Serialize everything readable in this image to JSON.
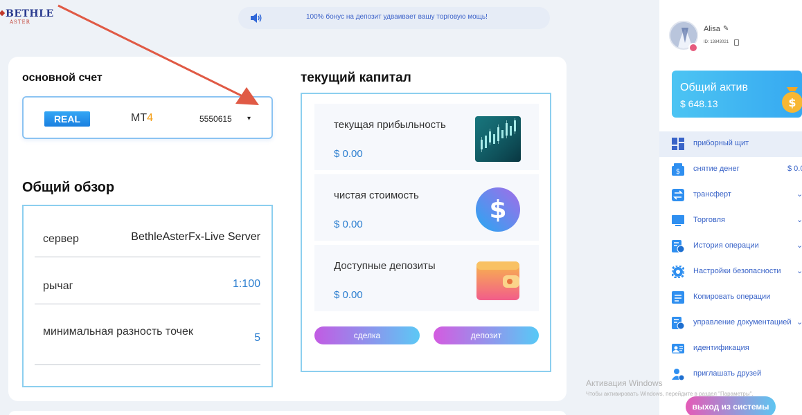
{
  "header": {
    "logo_main": "BETHLE",
    "logo_sub": "ASTER",
    "announcement": "100% бонус на депозит удваивает вашу торговую мощь!"
  },
  "account": {
    "title": "основной счет",
    "badge": "REAL",
    "platform_prefix": "MT",
    "platform_suffix": "4",
    "selected_account": "5550615"
  },
  "overview": {
    "title": "Общий обзор",
    "rows": [
      {
        "label": "сервер",
        "value": "BethleAsterFx-Live Server"
      },
      {
        "label": "рычаг",
        "value": "1:100"
      },
      {
        "label": "минимальная разность точек",
        "value": "5"
      }
    ]
  },
  "capital": {
    "title": "текущий капитал",
    "cards": [
      {
        "title": "текущая прибыльность",
        "value": "$ 0.00"
      },
      {
        "title": "чистая стоимость",
        "value": "$ 0.00"
      },
      {
        "title": "Доступные депозиты",
        "value": "$ 0.00"
      }
    ],
    "deal_button": "сделка",
    "deposit_button": "депозит"
  },
  "user": {
    "name": "Alisa",
    "id_label": "ID: 13843021"
  },
  "assets": {
    "title": "Общий актив",
    "value": "$ 648.13"
  },
  "nav": {
    "items": [
      {
        "label": "приборный щит",
        "icon": "dashboard-icon"
      },
      {
        "label": "снятие денег",
        "icon": "withdraw-icon",
        "extra": "$ 0.0"
      },
      {
        "label": "трансферт",
        "icon": "transfer-icon"
      },
      {
        "label": "Торговля",
        "icon": "trade-icon"
      },
      {
        "label": "История операции",
        "icon": "history-icon"
      },
      {
        "label": "Настройки безопасности",
        "icon": "gear-icon"
      },
      {
        "label": "Копировать операции",
        "icon": "copy-trade-icon"
      },
      {
        "label": "управление документацией",
        "icon": "documents-icon"
      },
      {
        "label": "идентификация",
        "icon": "id-card-icon"
      },
      {
        "label": "приглашать друзей",
        "icon": "invite-icon"
      }
    ],
    "logout": "выход из системы"
  },
  "watermark": {
    "title": "Активация Windows",
    "text": "Чтобы активировать Windows, перейдите в раздел \"Параметры\"."
  },
  "colors": {
    "accent": "#3a64c8",
    "value_blue": "#2d7fd0",
    "border": "#8ccfef",
    "arrow": "#e05a45"
  }
}
